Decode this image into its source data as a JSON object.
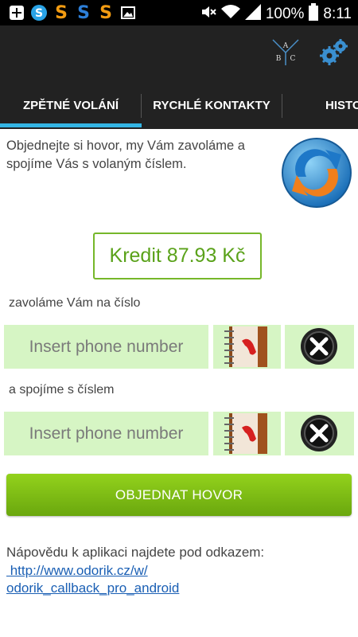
{
  "status_bar": {
    "battery": "100%",
    "time": "8:11",
    "icons": [
      "plus-icon",
      "skype-icon",
      "s-icon-orange",
      "s-icon-blue",
      "s-icon-orange",
      "image-icon",
      "mute-icon",
      "wifi-icon",
      "signal-icon",
      "battery-icon"
    ]
  },
  "action_bar": {
    "abc_letters": [
      "A",
      "B",
      "C"
    ]
  },
  "tabs": [
    {
      "label": "ZPĚTNÉ VOLÁNÍ",
      "active": true
    },
    {
      "label": "RYCHLÉ KONTAKTY",
      "active": false
    },
    {
      "label": "HISTO",
      "active": false
    }
  ],
  "intro": "Objednejte si hovor, my Vám zavoláme a spojíme Vás s volaným číslem.",
  "credit": "Kredit 87.93 Kč",
  "field1": {
    "label": "zavoláme Vám na číslo",
    "placeholder": "Insert phone number"
  },
  "field2": {
    "label": "a spojíme s číslem",
    "placeholder": "Insert phone number"
  },
  "order_button": "OBJEDNAT HOVOR",
  "help": {
    "text": "Nápovědu k aplikaci najdete pod odkazem:",
    "link_line1": " http://www.odorik.cz/w/",
    "link_line2": "odorik_callback_pro_android"
  },
  "colors": {
    "accent": "#33b5e5",
    "green": "#76b72a",
    "field_bg": "#d6f5c4"
  }
}
